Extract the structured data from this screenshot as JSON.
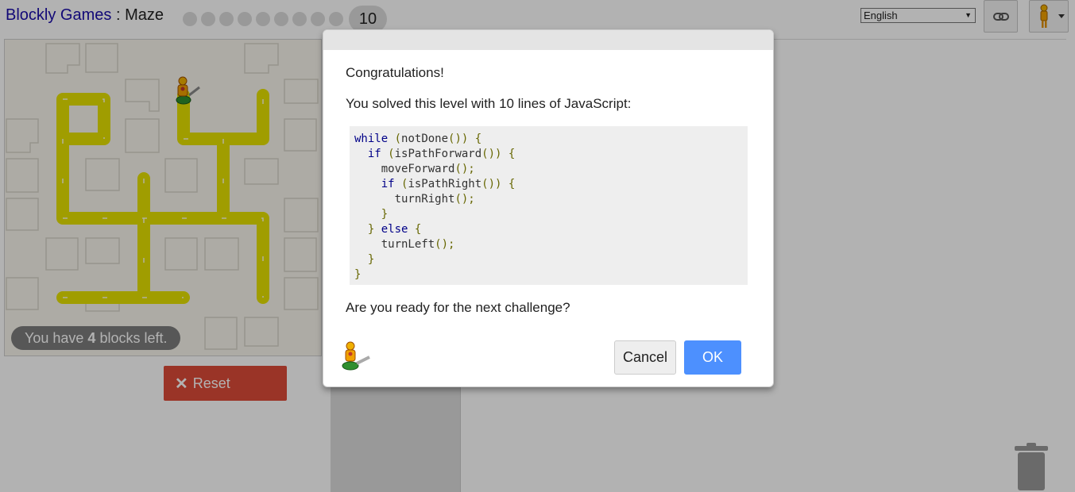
{
  "header": {
    "app_name": "Blockly Games",
    "separator": ":",
    "page_name": "Maze",
    "levels": [
      1,
      2,
      3,
      4,
      5,
      6,
      7,
      8,
      9
    ],
    "current_level": "10",
    "language": "English"
  },
  "maze": {
    "blocks_left_prefix": "You have ",
    "blocks_left_count": "4",
    "blocks_left_suffix": " blocks left.",
    "reset_label": "Reset"
  },
  "dialog": {
    "congrats": "Congratulations!",
    "solved_text": "You solved this level with 10 lines of JavaScript:",
    "code_lines": [
      [
        "kw:while",
        " ",
        "pn:(",
        "notDone",
        "pn:())",
        " ",
        "pn:{"
      ],
      [
        "  ",
        "kw:if",
        " ",
        "pn:(",
        "isPathForward",
        "pn:())",
        " ",
        "pn:{"
      ],
      [
        "    moveForward",
        "pn:();"
      ],
      [
        "    ",
        "kw:if",
        " ",
        "pn:(",
        "isPathRight",
        "pn:())",
        " ",
        "pn:{"
      ],
      [
        "      turnRight",
        "pn:();"
      ],
      [
        "    ",
        "pn:}"
      ],
      [
        "  ",
        "pn:}",
        " ",
        "kw:else",
        " ",
        "pn:{"
      ],
      [
        "    turnLeft",
        "pn:();"
      ],
      [
        "  ",
        "pn:}"
      ],
      [
        "pn:}"
      ]
    ],
    "next_question": "Are you ready for the next challenge?",
    "cancel_label": "Cancel",
    "ok_label": "OK"
  },
  "colors": {
    "path": "#e5e100",
    "reset_bg": "#dd4b39",
    "ok_bg": "#4d90fe",
    "link": "#1a0dab"
  }
}
